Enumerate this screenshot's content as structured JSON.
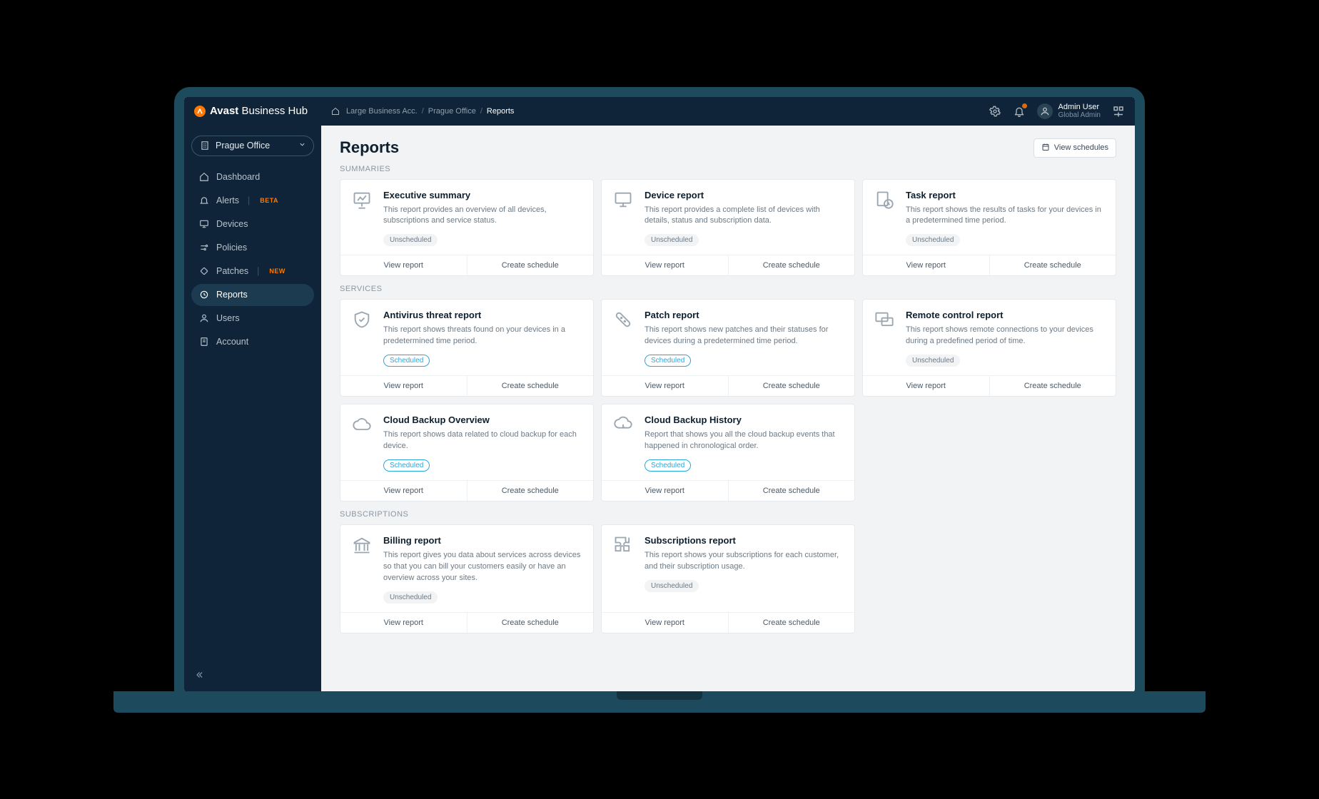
{
  "brand": {
    "bold": "Avast",
    "rest": "Business Hub"
  },
  "breadcrumb": {
    "home": "Large Business Acc.",
    "mid": "Prague Office",
    "current": "Reports"
  },
  "user": {
    "name": "Admin User",
    "role": "Global Admin"
  },
  "office": "Prague Office",
  "nav": {
    "dashboard": "Dashboard",
    "alerts": "Alerts",
    "alerts_tag": "BETA",
    "devices": "Devices",
    "policies": "Policies",
    "patches": "Patches",
    "patches_tag": "NEW",
    "reports": "Reports",
    "users": "Users",
    "account": "Account"
  },
  "page": {
    "title": "Reports",
    "viewSchedules": "View schedules"
  },
  "sections": {
    "summaries": "SUMMARIES",
    "services": "SERVICES",
    "subscriptions": "SUBSCRIPTIONS"
  },
  "labels": {
    "viewReport": "View report",
    "createSchedule": "Create schedule",
    "unscheduled": "Unscheduled",
    "scheduled": "Scheduled"
  },
  "cards": {
    "exec": {
      "title": "Executive summary",
      "desc": "This report provides an overview of all devices, subscriptions and service status.",
      "status": "unscheduled"
    },
    "device": {
      "title": "Device report",
      "desc": "This report provides a complete list of devices with details, status and subscription data.",
      "status": "unscheduled"
    },
    "task": {
      "title": "Task report",
      "desc": "This report shows the results of tasks for your devices in a predetermined time period.",
      "status": "unscheduled"
    },
    "av": {
      "title": "Antivirus threat report",
      "desc": "This report shows threats found on your devices in a predetermined time period.",
      "status": "scheduled"
    },
    "patch": {
      "title": "Patch report",
      "desc": "This report shows new patches and their statuses for devices during a predetermined time period.",
      "status": "scheduled"
    },
    "remote": {
      "title": "Remote control report",
      "desc": "This report shows remote connections to your devices during a predefined period of time.",
      "status": "unscheduled"
    },
    "cbo": {
      "title": "Cloud Backup Overview",
      "desc": "This report shows data related to cloud backup for each device.",
      "status": "scheduled"
    },
    "cbh": {
      "title": "Cloud Backup History",
      "desc": "Report that shows you all the cloud backup events that happened in chronological order.",
      "status": "scheduled"
    },
    "billing": {
      "title": "Billing report",
      "desc": "This report gives you data about services across devices so that you can bill your customers easily or have an overview across your sites.",
      "status": "unscheduled"
    },
    "subs": {
      "title": "Subscriptions report",
      "desc": "This report shows your subscriptions for each customer, and their subscription usage.",
      "status": "unscheduled"
    }
  }
}
